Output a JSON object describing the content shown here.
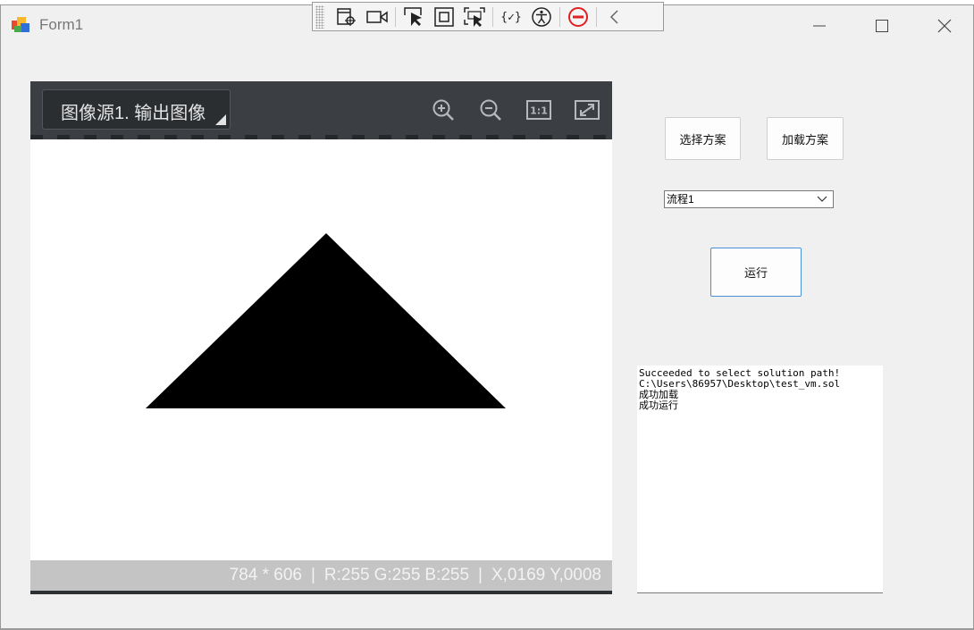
{
  "window": {
    "title": "Form1",
    "controls": {
      "minimize": "minimize-icon",
      "maximize": "maximize-icon",
      "close": "close-icon"
    }
  },
  "debug_toolbar": {
    "items": [
      "select-element-icon",
      "record-icon",
      "pointer-select-icon",
      "frame-icon",
      "track-focus-icon",
      "binding-icon",
      "accessibility-icon",
      "stop-icon",
      "collapse-icon"
    ]
  },
  "viewer": {
    "source_label": "图像源1. 输出图像",
    "tools": [
      "zoom-in-icon",
      "zoom-out-icon",
      "actual-size-icon",
      "fit-window-icon"
    ],
    "actual_size_label": "1:1",
    "image": {
      "shape": "triangle",
      "fill": "#000000",
      "background": "#ffffff"
    },
    "status": {
      "size": "784 * 606",
      "sep1": "|",
      "r": "R:255",
      "g": "G:255",
      "b": "B:255",
      "sep2": "|",
      "x": "X,0169",
      "y": "Y,0008"
    }
  },
  "controls": {
    "select_scheme": "选择方案",
    "load_scheme": "加载方案",
    "process_combo": "流程1",
    "run": "运行"
  },
  "log": {
    "lines": [
      "Succeeded to select solution path!",
      "C:\\Users\\86957\\Desktop\\test_vm.sol",
      "成功加载",
      "成功运行"
    ]
  },
  "colors": {
    "window_bg": "#f0f0f0",
    "viewer_toolbar": "#3b3f43",
    "status_bar": "#c4c4c4",
    "run_border": "#4a90d9",
    "stop_red": "#e02020"
  }
}
